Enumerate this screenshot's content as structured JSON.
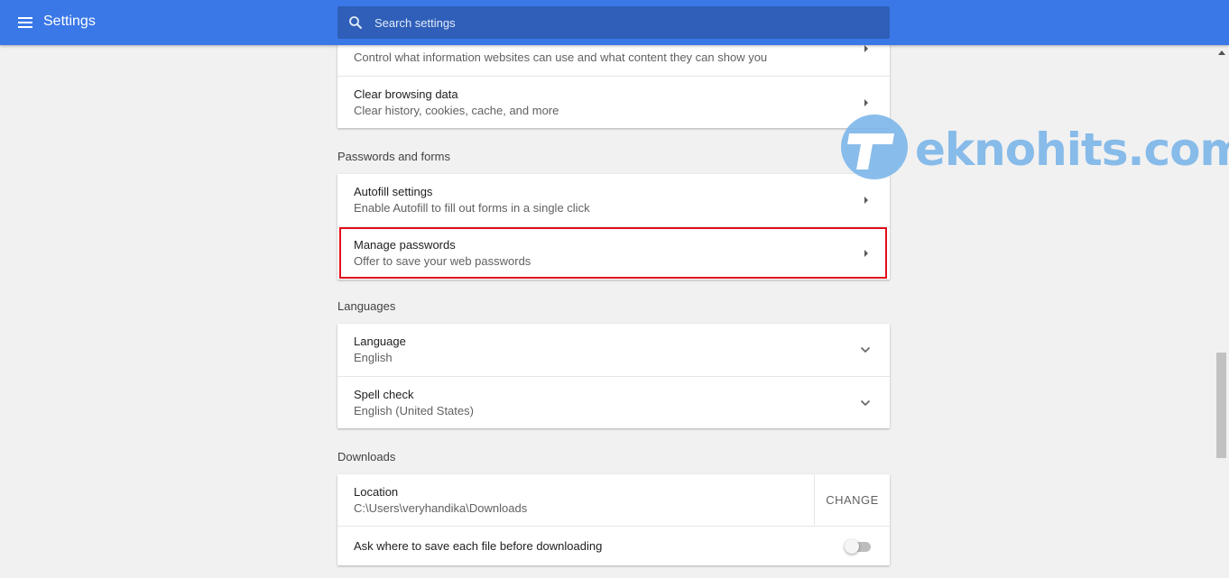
{
  "toolbar": {
    "title": "Settings",
    "search_placeholder": "Search settings"
  },
  "privacy": {
    "content_settings_subtitle": "Control what information websites can use and what content they can show you",
    "clear_browsing_title": "Clear browsing data",
    "clear_browsing_subtitle": "Clear history, cookies, cache, and more"
  },
  "passwords": {
    "section_title": "Passwords and forms",
    "autofill_title": "Autofill settings",
    "autofill_subtitle": "Enable Autofill to fill out forms in a single click",
    "manage_title": "Manage passwords",
    "manage_subtitle": "Offer to save your web passwords"
  },
  "languages": {
    "section_title": "Languages",
    "language_title": "Language",
    "language_value": "English",
    "spellcheck_title": "Spell check",
    "spellcheck_value": "English (United States)"
  },
  "downloads": {
    "section_title": "Downloads",
    "location_title": "Location",
    "location_value": "C:\\Users\\veryhandika\\Downloads",
    "change_label": "CHANGE",
    "ask_label": "Ask where to save each file before downloading",
    "ask_enabled": false
  },
  "watermark": {
    "text": "eknohits.com",
    "color": "#7fb7e9"
  },
  "colors": {
    "toolbar": "#3b78e7",
    "highlight": "#e10d1b"
  }
}
